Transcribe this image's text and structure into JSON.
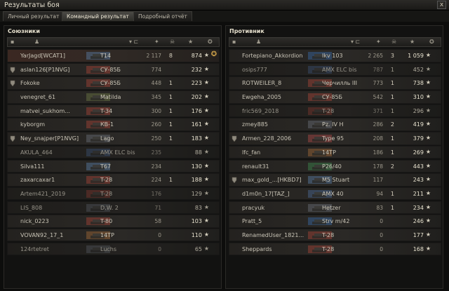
{
  "window": {
    "title": "Результаты боя",
    "close_label": "x"
  },
  "tabs": [
    {
      "label": "Личный результат",
      "active": false
    },
    {
      "label": "Командный результат",
      "active": true
    },
    {
      "label": "Подробный отчёт",
      "active": false
    }
  ],
  "allies": {
    "title": "Союзники",
    "rows": [
      {
        "player": "YarJagd[WCAT1]",
        "tank": "T14",
        "damage": "2 117",
        "kills": "8",
        "xp": "874",
        "platoon": false,
        "dead": false,
        "self": true,
        "medal": true,
        "nation": "usa"
      },
      {
        "player": "aslan126[P1NVG]",
        "tank": "СУ-85Б",
        "damage": "774",
        "kills": "",
        "xp": "232",
        "platoon": true,
        "dead": false,
        "self": false,
        "medal": false,
        "nation": "ussr"
      },
      {
        "player": "Fokoke",
        "tank": "СУ-85Б",
        "damage": "448",
        "kills": "1",
        "xp": "223",
        "platoon": true,
        "dead": false,
        "self": false,
        "medal": false,
        "nation": "ussr"
      },
      {
        "player": "venegret_61",
        "tank": "Matilda",
        "damage": "345",
        "kills": "1",
        "xp": "202",
        "platoon": false,
        "dead": false,
        "self": false,
        "medal": false,
        "nation": "uk"
      },
      {
        "player": "matvei_sukhom...",
        "tank": "T-34",
        "damage": "300",
        "kills": "1",
        "xp": "176",
        "platoon": false,
        "dead": false,
        "self": false,
        "medal": false,
        "nation": "ussr"
      },
      {
        "player": "kyborgm",
        "tank": "КВ-1",
        "damage": "260",
        "kills": "1",
        "xp": "161",
        "platoon": false,
        "dead": false,
        "self": false,
        "medal": false,
        "nation": "ussr"
      },
      {
        "player": "Ney_snajper[P1NVG]",
        "tank": "Lago",
        "damage": "250",
        "kills": "1",
        "xp": "183",
        "platoon": true,
        "dead": false,
        "self": false,
        "medal": false,
        "nation": "germany"
      },
      {
        "player": "AKULA_464",
        "tank": "AMX ELC bis",
        "damage": "235",
        "kills": "",
        "xp": "88",
        "platoon": false,
        "dead": true,
        "self": false,
        "medal": false,
        "nation": "france"
      },
      {
        "player": "Silva111",
        "tank": "T67",
        "damage": "234",
        "kills": "",
        "xp": "130",
        "platoon": false,
        "dead": false,
        "self": false,
        "medal": false,
        "nation": "usa"
      },
      {
        "player": "zaxarcaxar1",
        "tank": "T-28",
        "damage": "224",
        "kills": "1",
        "xp": "188",
        "platoon": false,
        "dead": false,
        "self": false,
        "medal": false,
        "nation": "ussr"
      },
      {
        "player": "Artem421_2019",
        "tank": "T-28",
        "damage": "176",
        "kills": "",
        "xp": "129",
        "platoon": false,
        "dead": true,
        "self": false,
        "medal": false,
        "nation": "ussr"
      },
      {
        "player": "LIS_808",
        "tank": "D.W. 2",
        "damage": "71",
        "kills": "",
        "xp": "83",
        "platoon": false,
        "dead": true,
        "self": false,
        "medal": false,
        "nation": "germany"
      },
      {
        "player": "nick_0223",
        "tank": "T-80",
        "damage": "58",
        "kills": "",
        "xp": "103",
        "platoon": false,
        "dead": false,
        "self": false,
        "medal": false,
        "nation": "ussr"
      },
      {
        "player": "VOVAN92_17_1",
        "tank": "14TP",
        "damage": "0",
        "kills": "",
        "xp": "110",
        "platoon": false,
        "dead": false,
        "self": false,
        "medal": false,
        "nation": "poland"
      },
      {
        "player": "124rtetret",
        "tank": "Luchs",
        "damage": "0",
        "kills": "",
        "xp": "65",
        "platoon": false,
        "dead": true,
        "self": false,
        "medal": false,
        "nation": "germany"
      }
    ]
  },
  "enemies": {
    "title": "Противник",
    "rows": [
      {
        "player": "Fortepiano_Akkordion",
        "tank": "Ikv 103",
        "damage": "2 265",
        "kills": "3",
        "xp": "1 059",
        "platoon": false,
        "dead": false,
        "self": false,
        "medal": false,
        "nation": "sweden"
      },
      {
        "player": "osips777",
        "tank": "AMX ELC bis",
        "damage": "787",
        "kills": "1",
        "xp": "452",
        "platoon": false,
        "dead": true,
        "self": false,
        "medal": false,
        "nation": "france"
      },
      {
        "player": "ROTWEILER_8",
        "tank": "Черчилль III",
        "damage": "773",
        "kills": "1",
        "xp": "738",
        "platoon": false,
        "dead": false,
        "self": false,
        "medal": false,
        "nation": "ussr"
      },
      {
        "player": "Ewgeha_2005",
        "tank": "СУ-85Б",
        "damage": "542",
        "kills": "1",
        "xp": "310",
        "platoon": false,
        "dead": false,
        "self": false,
        "medal": false,
        "nation": "ussr"
      },
      {
        "player": "fric569_2018",
        "tank": "T-28",
        "damage": "371",
        "kills": "1",
        "xp": "296",
        "platoon": false,
        "dead": true,
        "self": false,
        "medal": false,
        "nation": "ussr"
      },
      {
        "player": "zmey885",
        "tank": "Pz. IV H",
        "damage": "286",
        "kills": "2",
        "xp": "419",
        "platoon": false,
        "dead": false,
        "self": false,
        "medal": false,
        "nation": "germany"
      },
      {
        "player": "Armen_228_2006",
        "tank": "Type 95",
        "damage": "208",
        "kills": "1",
        "xp": "379",
        "platoon": true,
        "dead": false,
        "self": false,
        "medal": false,
        "nation": "japan"
      },
      {
        "player": "lfc_fan",
        "tank": "14TP",
        "damage": "186",
        "kills": "1",
        "xp": "269",
        "platoon": false,
        "dead": false,
        "self": false,
        "medal": false,
        "nation": "poland"
      },
      {
        "player": "renault31",
        "tank": "P26/40",
        "damage": "178",
        "kills": "2",
        "xp": "443",
        "platoon": false,
        "dead": false,
        "self": false,
        "medal": false,
        "nation": "italy"
      },
      {
        "player": "max_gold_...[HKBD7]",
        "tank": "M5 Stuart",
        "damage": "117",
        "kills": "",
        "xp": "243",
        "platoon": true,
        "dead": false,
        "self": false,
        "medal": false,
        "nation": "usa"
      },
      {
        "player": "d1m0n_17[TAZ_]",
        "tank": "AMX 40",
        "damage": "94",
        "kills": "1",
        "xp": "211",
        "platoon": false,
        "dead": false,
        "self": false,
        "medal": false,
        "nation": "france"
      },
      {
        "player": "pracyuk",
        "tank": "Hetzer",
        "damage": "83",
        "kills": "1",
        "xp": "234",
        "platoon": false,
        "dead": false,
        "self": false,
        "medal": false,
        "nation": "germany"
      },
      {
        "player": "Pratt_5",
        "tank": "Strv m/42",
        "damage": "0",
        "kills": "",
        "xp": "246",
        "platoon": false,
        "dead": false,
        "self": false,
        "medal": false,
        "nation": "sweden"
      },
      {
        "player": "RenamedUser_1821...",
        "tank": "T-28",
        "damage": "0",
        "kills": "",
        "xp": "177",
        "platoon": false,
        "dead": false,
        "self": false,
        "medal": false,
        "nation": "ussr"
      },
      {
        "player": "Sheppards",
        "tank": "T-28",
        "damage": "0",
        "kills": "",
        "xp": "168",
        "platoon": false,
        "dead": false,
        "self": false,
        "medal": false,
        "nation": "ussr"
      }
    ]
  },
  "icons": {
    "platoon": "platoon-shield-icon",
    "player": "player-icon",
    "tank": "tank-silhouette-icon",
    "damage": "damage-icon",
    "kills": "kills-icon",
    "xp": "experience-star-icon",
    "medal": "medal-icon"
  },
  "colors": {
    "background": "#0d0d0c",
    "row": "#2b2926",
    "self_row": "#3b2822",
    "text": "#c9c4b6",
    "accent": "#d1a44a",
    "nation_colors": {
      "usa": "#5a7ea8",
      "ussr": "#a8443a",
      "germany": "#6b6f7a",
      "uk": "#6e7a48",
      "france": "#4b6a9a",
      "sweden": "#3a6aa8",
      "japan": "#b04a4a",
      "poland": "#a36a3a",
      "italy": "#3f8a4f"
    }
  }
}
